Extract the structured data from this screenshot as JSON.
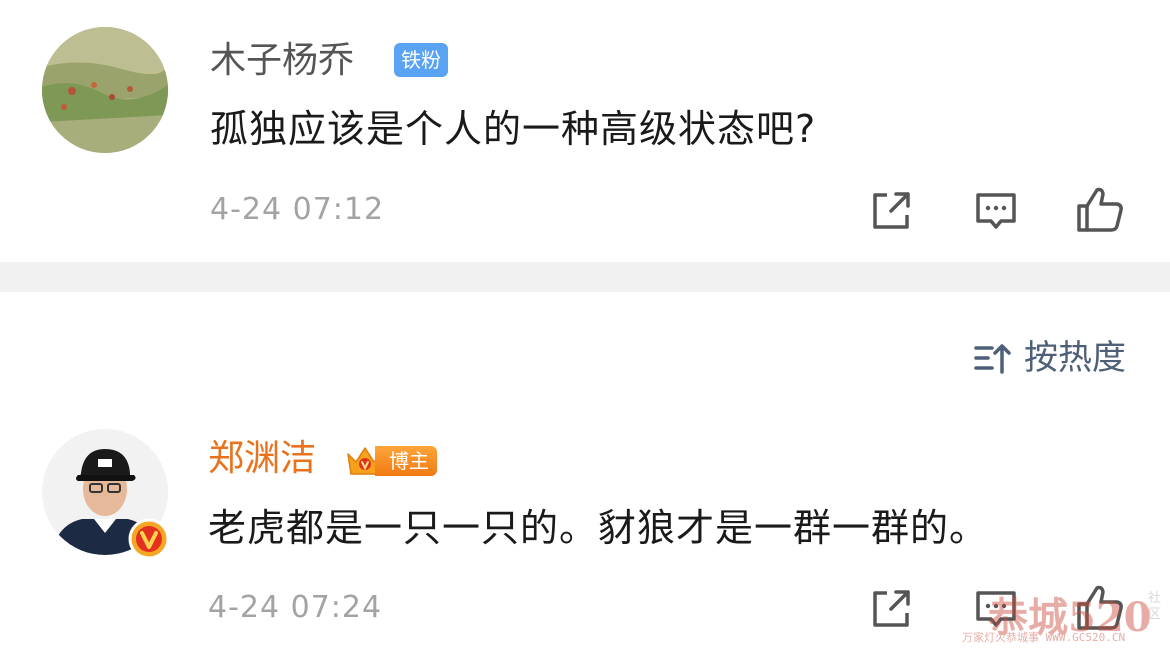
{
  "comments": [
    {
      "username": "木子杨乔",
      "badge": "铁粉",
      "text": "孤独应该是个人的一种高级状态吧?",
      "time": "4-24 07:12"
    },
    {
      "username": "郑渊洁",
      "badge": "博主",
      "text": "老虎都是一只一只的。豺狼才是一群一群的。",
      "time": "4-24 07:24"
    }
  ],
  "sort": {
    "label": "按热度"
  },
  "watermark": {
    "main": "恭城520",
    "sub": "万家灯火恭城事 WWW.GC520.CN",
    "side": "社区"
  },
  "colors": {
    "username_default": "#555555",
    "username_blogger": "#e8721e",
    "fan_badge": "#5aa2f2",
    "blogger_badge": "#f07a12",
    "icon_stroke": "#555555",
    "sort_accent": "#4e5f78"
  },
  "icons": [
    "share-icon",
    "comment-icon",
    "like-icon",
    "sort-icon",
    "crown-icon",
    "verified-icon"
  ]
}
